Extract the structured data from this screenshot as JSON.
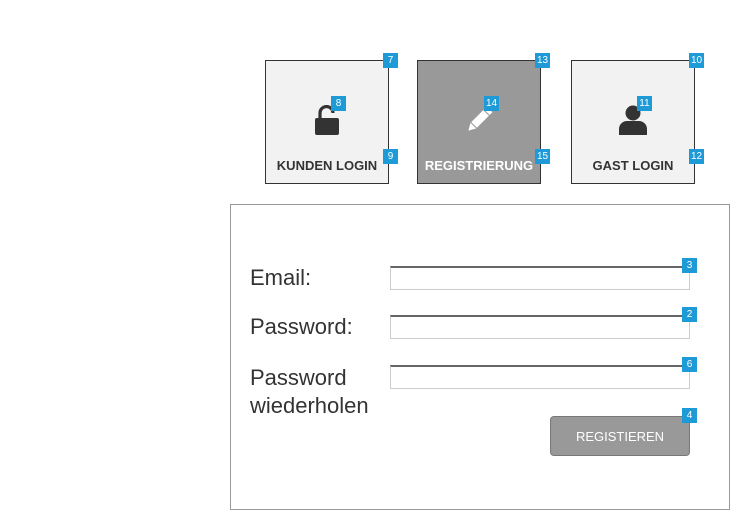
{
  "tiles": [
    {
      "label": "KUNDEN LOGIN",
      "icon": "lock-open-icon",
      "active": false
    },
    {
      "label": "REGISTRIERUNG",
      "icon": "pencil-icon",
      "active": true
    },
    {
      "label": "GAST LOGIN",
      "icon": "user-icon",
      "active": false
    }
  ],
  "badges": {
    "kunden_login": "7",
    "kunden_login_icon": "8",
    "kunden_login_label": "9",
    "registrierung": "13",
    "registrierung_icon": "14",
    "registrierung_label": "15",
    "gast_login": "10",
    "gast_login_icon": "11",
    "gast_login_label": "12",
    "email": "3",
    "password": "2",
    "password_repeat": "6",
    "register_button": "4"
  },
  "form": {
    "email_label": "Email:",
    "email_value": "",
    "password_label": "Password:",
    "password_value": "",
    "password_repeat_label_line1": "Password",
    "password_repeat_label_line2": "wiederholen",
    "password_repeat_value": "",
    "submit_label": "REGISTIEREN"
  },
  "colors": {
    "badge": "#1e9bd7",
    "tile_bg": "#f2f2f2",
    "tile_active_bg": "#999999",
    "button_bg": "#999999"
  }
}
